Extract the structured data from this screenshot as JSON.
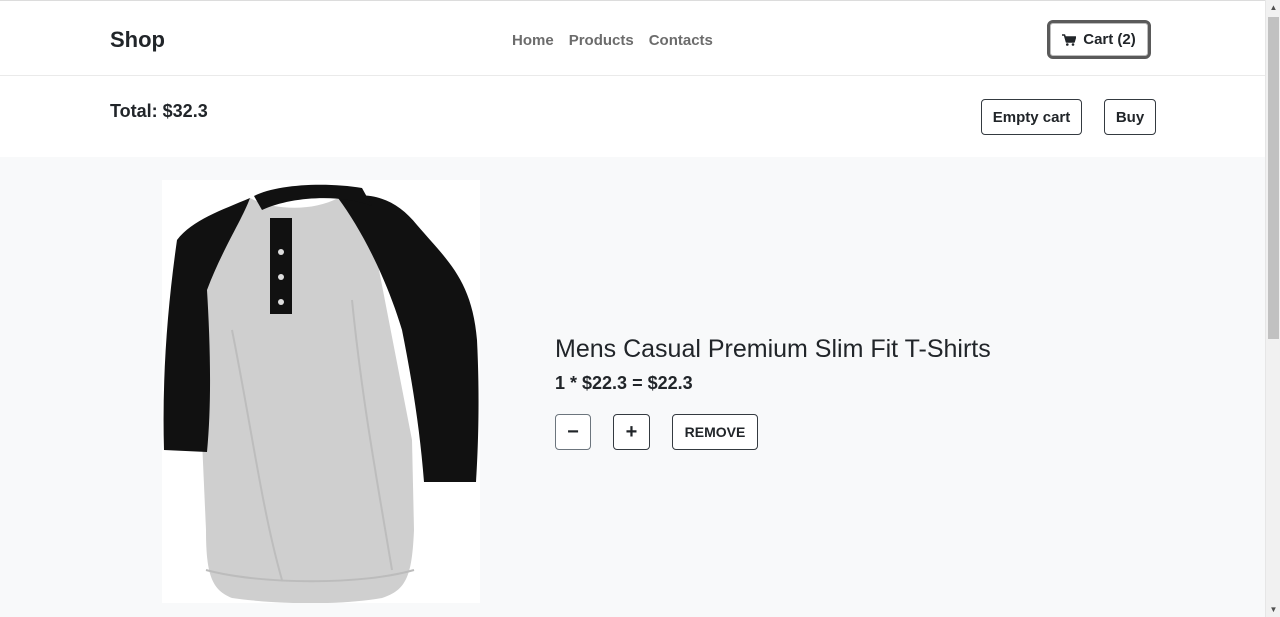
{
  "navbar": {
    "brand": "Shop",
    "links": [
      "Home",
      "Products",
      "Contacts"
    ],
    "cart_label": "Cart (2)",
    "cart_icon": "cart-icon"
  },
  "summary": {
    "total_label": "Total: $32.3",
    "empty_cart_label": "Empty cart",
    "buy_label": "Buy"
  },
  "cart_item": {
    "title": "Mens Casual Premium Slim Fit T-Shirts",
    "calc": "1 * $22.3 = $22.3",
    "minus_label": "−",
    "plus_label": "+",
    "remove_label": "REMOVE",
    "image": "raglan-henley-tshirt-image"
  },
  "colors": {
    "content_bg": "#f8f9fa",
    "text": "#212529",
    "nav_link": "#6c6c6c"
  }
}
